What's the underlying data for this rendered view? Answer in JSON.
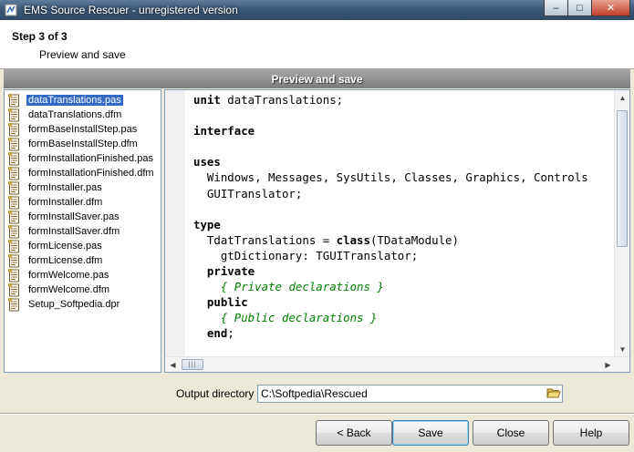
{
  "window": {
    "title": "EMS Source Rescuer - unregistered version",
    "controls": {
      "minimize": "–",
      "maximize": "□",
      "close": "✕"
    }
  },
  "step": {
    "title": "Step 3 of 3",
    "subtitle": "Preview and save"
  },
  "panel": {
    "header": "Preview and save"
  },
  "files": [
    {
      "name": "dataTranslations.pas",
      "selected": true
    },
    {
      "name": "dataTranslations.dfm",
      "selected": false
    },
    {
      "name": "formBaseInstallStep.pas",
      "selected": false
    },
    {
      "name": "formBaseInstallStep.dfm",
      "selected": false
    },
    {
      "name": "formInstallationFinished.pas",
      "selected": false
    },
    {
      "name": "formInstallationFinished.dfm",
      "selected": false
    },
    {
      "name": "formInstaller.pas",
      "selected": false
    },
    {
      "name": "formInstaller.dfm",
      "selected": false
    },
    {
      "name": "formInstallSaver.pas",
      "selected": false
    },
    {
      "name": "formInstallSaver.dfm",
      "selected": false
    },
    {
      "name": "formLicense.pas",
      "selected": false
    },
    {
      "name": "formLicense.dfm",
      "selected": false
    },
    {
      "name": "formWelcome.pas",
      "selected": false
    },
    {
      "name": "formWelcome.dfm",
      "selected": false
    },
    {
      "name": "Setup_Softpedia.dpr",
      "selected": false
    }
  ],
  "code": {
    "lines": [
      [
        {
          "t": "unit",
          "k": "kw"
        },
        {
          "t": " dataTranslations;"
        }
      ],
      [
        {
          "t": ""
        }
      ],
      [
        {
          "t": "interface",
          "k": "kw"
        }
      ],
      [
        {
          "t": ""
        }
      ],
      [
        {
          "t": "uses",
          "k": "kw"
        }
      ],
      [
        {
          "t": "  Windows, Messages, SysUtils, Classes, Graphics, Controls"
        }
      ],
      [
        {
          "t": "  GUITranslator;"
        }
      ],
      [
        {
          "t": ""
        }
      ],
      [
        {
          "t": "type",
          "k": "kw"
        }
      ],
      [
        {
          "t": "  TdatTranslations = "
        },
        {
          "t": "class",
          "k": "kw"
        },
        {
          "t": "(TDataModule)"
        }
      ],
      [
        {
          "t": "    gtDictionary: TGUITranslator;"
        }
      ],
      [
        {
          "t": "  "
        },
        {
          "t": "private",
          "k": "kw"
        }
      ],
      [
        {
          "t": "    "
        },
        {
          "t": "{ Private declarations }",
          "k": "cm"
        }
      ],
      [
        {
          "t": "  "
        },
        {
          "t": "public",
          "k": "kw"
        }
      ],
      [
        {
          "t": "    "
        },
        {
          "t": "{ Public declarations }",
          "k": "cm"
        }
      ],
      [
        {
          "t": "  "
        },
        {
          "t": "end",
          "k": "kw"
        },
        {
          "t": ";"
        }
      ]
    ]
  },
  "output": {
    "label": "Output directory",
    "value": "C:\\Softpedia\\Rescued"
  },
  "buttons": {
    "back": "< Back",
    "save": "Save",
    "close": "Close",
    "help": "Help"
  },
  "colors": {
    "selection": "#316ac5",
    "comment": "#008000",
    "title_bar": "#3c5a78"
  },
  "icons": {
    "app": "app-icon",
    "file": "file-icon",
    "browse": "folder-open-icon"
  }
}
